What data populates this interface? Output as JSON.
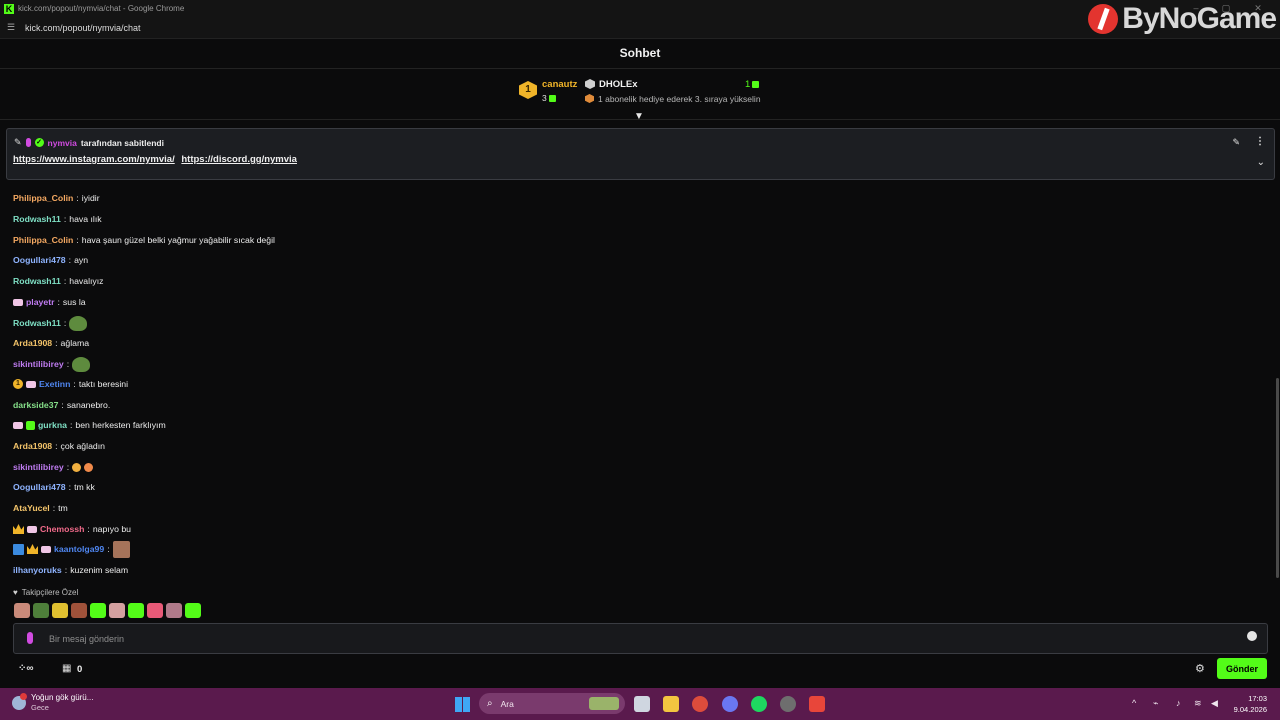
{
  "browser": {
    "window_title": "kick.com/popout/nymvia/chat - Google Chrome",
    "url": "kick.com/popout/nymvia/chat",
    "overlay_logo": "ByNoGame"
  },
  "chat": {
    "title": "Sohbet",
    "leaderboard": {
      "rank1_badge": "1",
      "rank1_name": "canautz",
      "rank1_count": "3",
      "current_name": "DHOLEx",
      "current_count": "1",
      "upgrade_hint": "1 abonelik hediye ederek 3. sıraya yükselin"
    },
    "pinned": {
      "user": "nymvia",
      "by_text": "tarafından sabitlendi",
      "link1": "https://www.instagram.com/nymvia/",
      "link2": "https://discord.gg/nymvia"
    },
    "messages": [
      {
        "user": "Philippa_Colin",
        "text": "iyidir"
      },
      {
        "user": "Rodwash11",
        "text": "hava ılık"
      },
      {
        "user": "Philippa_Colin",
        "text": "hava şaun güzel belki yağmur yağabilir sıcak değil"
      },
      {
        "user": "Oogullari478",
        "text": "ayn"
      },
      {
        "user": "Rodwash11",
        "text": "havalıyız"
      },
      {
        "user": "playetr",
        "text": "sus la"
      },
      {
        "user": "Rodwash11",
        "text": ""
      },
      {
        "user": "Arda1908",
        "text": "ağlama"
      },
      {
        "user": "sikintilibirey",
        "text": ""
      },
      {
        "user": "Exetinn",
        "text": "taktı beresini"
      },
      {
        "user": "darkside37",
        "text": "sananebro."
      },
      {
        "user": "gurkna",
        "text": "ben herkesten farklıyım"
      },
      {
        "user": "Arda1908",
        "text": "çok ağladın"
      },
      {
        "user": "sikintilibirey",
        "text": ""
      },
      {
        "user": "Oogullari478",
        "text": "tm kk"
      },
      {
        "user": "AtaYucel",
        "text": "tm"
      },
      {
        "user": "Chemossh",
        "text": "napıyo bu"
      },
      {
        "user": "kaantolga99",
        "text": ""
      },
      {
        "user": "ilhanyoruks",
        "text": "kuzenim selam"
      }
    ],
    "followers_only_label": "Takipçilere Özel",
    "input_placeholder": "Bir mesaj gönderin",
    "points_count": "0",
    "send_label": "Gönder"
  },
  "colors": {
    "accent": "#53fc18",
    "user_orange": "#f5a962",
    "user_cyan": "#7fe0c5",
    "user_blue": "#8fb4ff",
    "user_purple": "#c07cf2",
    "user_pink": "#f06a8a",
    "user_royal": "#4f86f0",
    "user_gold": "#f4c46a",
    "user_green": "#86e08a"
  },
  "taskbar": {
    "weather_title": "Yoğun gök gürü...",
    "weather_sub": "Gece",
    "weather_badge": "5",
    "search_label": "Ara",
    "time": "17:03",
    "date": "9.04.2026"
  }
}
